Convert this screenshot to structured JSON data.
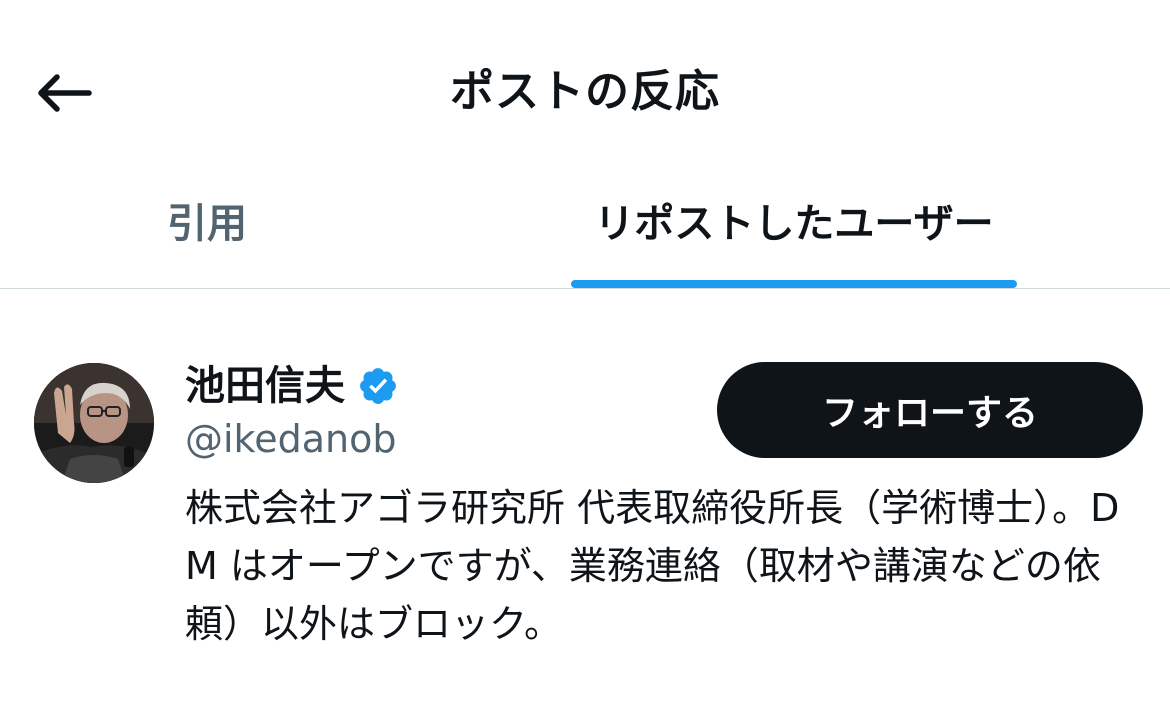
{
  "header": {
    "title": "ポストの反応",
    "back_icon": "arrow-left-icon"
  },
  "tabs": [
    {
      "label": "引用",
      "active": false
    },
    {
      "label": "リポストしたユーザー",
      "active": true
    }
  ],
  "colors": {
    "accent": "#1d9bf0",
    "text_primary": "#0f1419",
    "text_secondary": "#536471",
    "button_bg": "#0f1419",
    "divider": "#cfd9de"
  },
  "user": {
    "display_name": "池田信夫",
    "verified": true,
    "verified_icon": "verified-badge-icon",
    "handle": "@ikedanob",
    "follow_label": "フォローする",
    "bio": "株式会社アゴラ研究所 代表取締役所長（学術博士）。DM はオープンですが、業務連絡（取材や講演などの依頼）以外はブロック。"
  }
}
